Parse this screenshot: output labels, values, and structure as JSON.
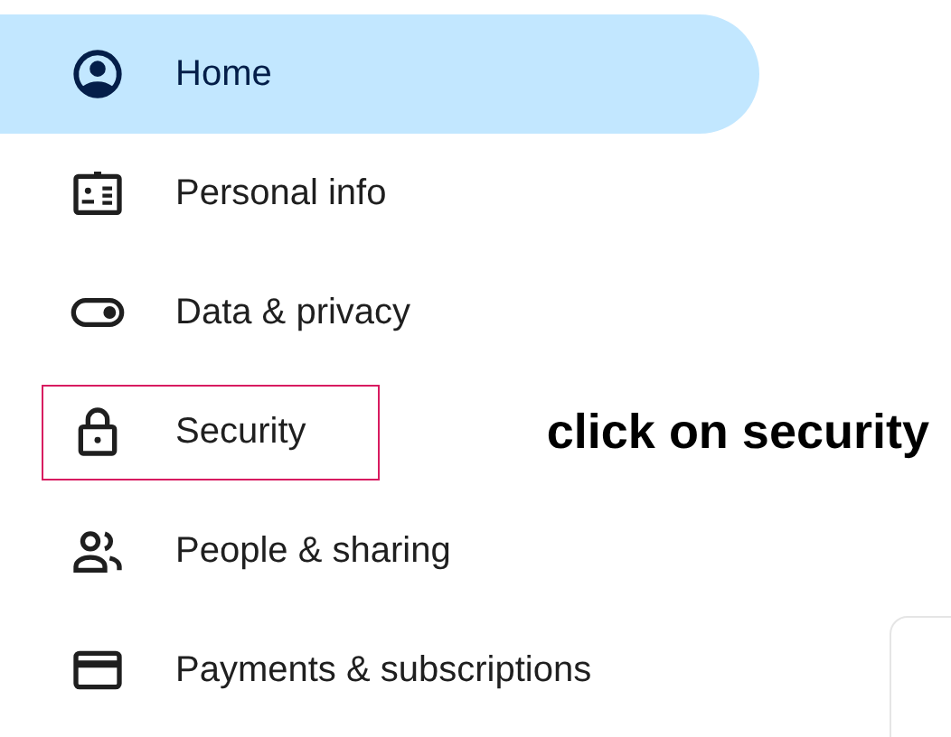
{
  "nav_items": [
    {
      "kind": "account",
      "label": "Home",
      "selected": true,
      "annotated": false
    },
    {
      "kind": "profile",
      "label": "Personal info",
      "selected": false,
      "annotated": false
    },
    {
      "kind": "toggle",
      "label": "Data & privacy",
      "selected": false,
      "annotated": false
    },
    {
      "kind": "lock",
      "label": "Security",
      "selected": false,
      "annotated": true,
      "annotation": "click on security"
    },
    {
      "kind": "people",
      "label": "People & sharing",
      "selected": false,
      "annotated": false
    },
    {
      "kind": "card",
      "label": "Payments & subscriptions",
      "selected": false,
      "annotated": false
    }
  ]
}
